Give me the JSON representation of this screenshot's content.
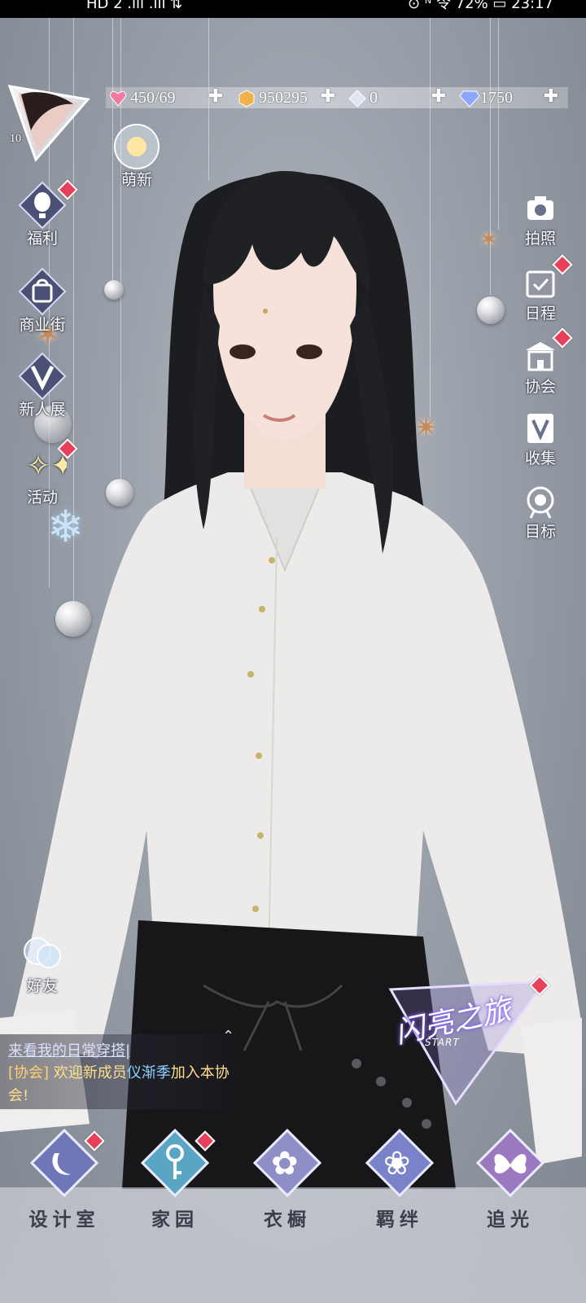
{
  "status_bar": {
    "left_text": "HD 2  .ıll  .ıll  ⇅",
    "right_text": "⊙ ᴺ 令 72%  ▭  23:17"
  },
  "player": {
    "level": "10",
    "avatar_icon": "player-avatar"
  },
  "resources": [
    {
      "name": "stamina",
      "icon": "heart-gem-icon",
      "value": "450/69",
      "color": "#f07aa0"
    },
    {
      "name": "gold",
      "icon": "gold-coin-icon",
      "value": "950295",
      "color": "#f0b24a"
    },
    {
      "name": "crystal",
      "icon": "white-crystal-icon",
      "value": "0",
      "color": "#dfe6f2"
    },
    {
      "name": "diamond",
      "icon": "diamond-icon",
      "value": "1750",
      "color": "#8ea6ff"
    }
  ],
  "floating": {
    "mengxin": "萌新"
  },
  "left_menu": [
    {
      "id": "fuli",
      "label": "福利",
      "icon": "hot-air-balloon-icon",
      "badge": true
    },
    {
      "id": "shangyejie",
      "label": "商业街",
      "icon": "shopping-bag-icon",
      "badge": false
    },
    {
      "id": "xinrenzhan",
      "label": "新人展",
      "icon": "v-crown-icon",
      "badge": false
    },
    {
      "id": "huodong",
      "label": "活动",
      "icon": "stars-icon",
      "badge": true
    }
  ],
  "right_menu": [
    {
      "id": "paizhao",
      "label": "拍照",
      "icon": "camera-icon",
      "badge": false
    },
    {
      "id": "richeng",
      "label": "日程",
      "icon": "calendar-check-icon",
      "badge": true
    },
    {
      "id": "xiehui",
      "label": "协会",
      "icon": "guild-building-icon",
      "badge": true
    },
    {
      "id": "shouji",
      "label": "收集",
      "icon": "v-collection-icon",
      "badge": false
    },
    {
      "id": "mubiao",
      "label": "目标",
      "icon": "target-badge-icon",
      "badge": false
    }
  ],
  "friends": {
    "label": "好友"
  },
  "chat": {
    "line1": "来看我的日常穿搭|",
    "tag": "[协会]",
    "msg_pre": "欢迎新成员",
    "member": "仪渐季",
    "msg_post": "加入本协会!"
  },
  "start_banner": {
    "title": "闪亮之旅",
    "subtitle": "START"
  },
  "bottom_nav": [
    {
      "id": "design",
      "label": "设计室",
      "icon": "moon-pen-icon",
      "badge": true,
      "tint": "#6f77b8"
    },
    {
      "id": "home",
      "label": "家园",
      "icon": "key-icon",
      "badge": true,
      "tint": "#5aa4c4"
    },
    {
      "id": "wardrobe",
      "label": "衣橱",
      "icon": "flower-gem-icon",
      "badge": false,
      "tint": "#8d8fc6"
    },
    {
      "id": "bonds",
      "label": "羁绊",
      "icon": "clover-gem-icon",
      "badge": false,
      "tint": "#7a82c9"
    },
    {
      "id": "chase",
      "label": "追光",
      "icon": "butterfly-icon",
      "badge": false,
      "tint": "#9b78c0"
    }
  ]
}
